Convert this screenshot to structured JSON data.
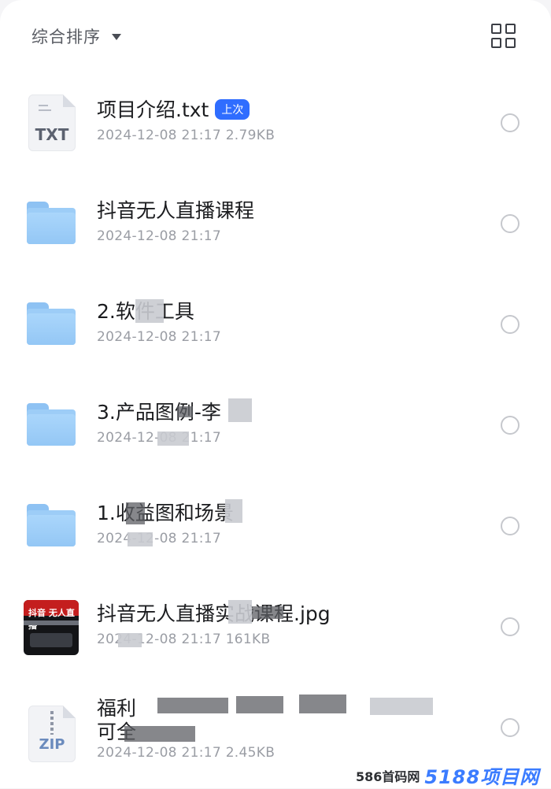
{
  "header": {
    "sort_label": "综合排序",
    "sort_icon": "caret-down-icon",
    "view_icon": "grid-view-icon"
  },
  "files": [
    {
      "name": "项目介绍.txt",
      "badge": "上次",
      "meta": "2024-12-08 21:17  2.79KB",
      "type": "txt",
      "icon_label": "TXT"
    },
    {
      "name": "抖音无人直播课程",
      "meta": "2024-12-08 21:17",
      "type": "folder"
    },
    {
      "name": "2.软件工具",
      "meta": "2024-12-08 21:17",
      "type": "folder"
    },
    {
      "name": "3.产品图例-李",
      "meta": "2024-12-08 21:17",
      "type": "folder"
    },
    {
      "name": "1.收益图和场景",
      "meta": "2024-12-08 21:17",
      "type": "folder"
    },
    {
      "name": "抖音无人直播实战课程.jpg",
      "meta": "2024-12-08 21:17  161KB",
      "type": "image",
      "thumb_text": "抖音 无人直播"
    },
    {
      "name_line1": "福利",
      "name_line2": "可全",
      "meta": "2024-12-08 21:17  2.45KB",
      "type": "zip",
      "icon_label": "ZIP"
    }
  ],
  "watermark": {
    "text": "586首码网",
    "logo": "5188项目网"
  },
  "colors": {
    "accent": "#2f6dff",
    "folder": "#9dcdf7"
  }
}
